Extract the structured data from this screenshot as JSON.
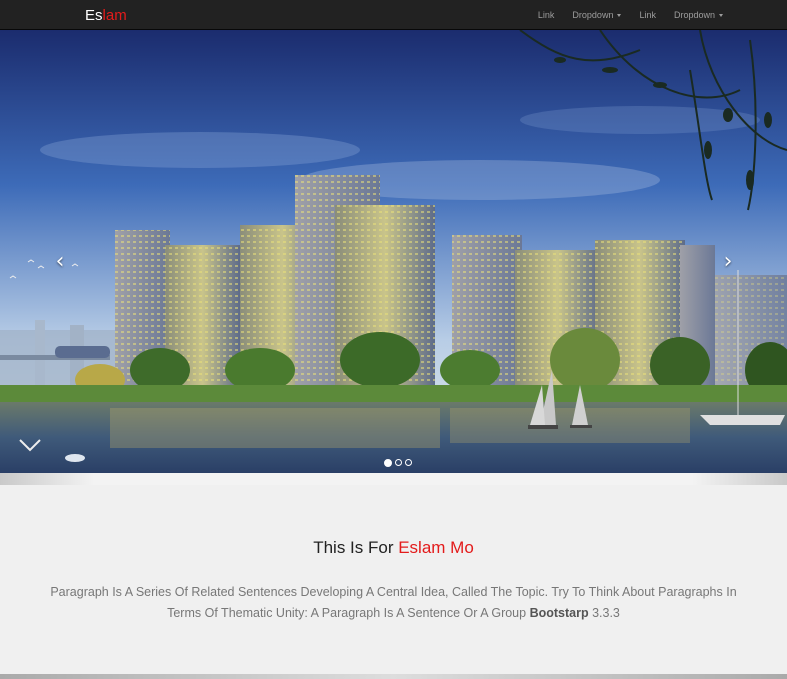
{
  "brand": {
    "part1": "Es",
    "part2": "lam"
  },
  "nav": {
    "items": [
      {
        "label": "Link",
        "dropdown": false
      },
      {
        "label": "Dropdown",
        "dropdown": true
      },
      {
        "label": "Link",
        "dropdown": false
      },
      {
        "label": "Dropdown",
        "dropdown": true
      }
    ]
  },
  "carousel": {
    "slide_count": 3,
    "active_index": 0,
    "prev_glyph": "‹",
    "next_glyph": "›"
  },
  "intro": {
    "title_prefix": "This Is For ",
    "title_name": "Eslam Mo",
    "paragraph_text": "Paragraph Is A Series Of Related Sentences Developing A Central Idea, Called The Topic. Try To Think About Paragraphs In Terms Of Thematic Unity: A Paragraph Is A Sentence Or A Group ",
    "paragraph_bold": "Bootstarp",
    "paragraph_version": " 3.3.3"
  },
  "colors": {
    "accent": "#e31b1b",
    "navbar_bg": "#222222",
    "page_bg": "#f0f0f0"
  }
}
